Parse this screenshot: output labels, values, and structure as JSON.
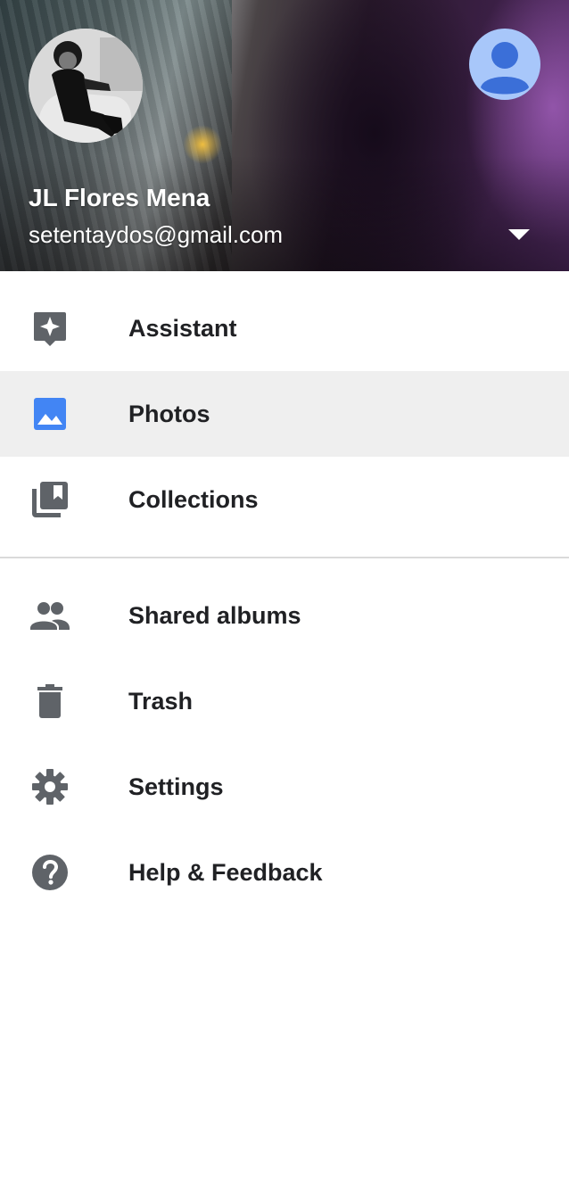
{
  "account": {
    "name": "JL Flores Mena",
    "email": "setentaydos@gmail.com"
  },
  "icons": {
    "profile": "profile-photo",
    "switch_account": "account-circle-icon",
    "dropdown": "arrow-drop-down-icon"
  },
  "colors": {
    "accent": "#4285f4",
    "icon_gray": "#5f6368",
    "selected_bg": "#efefef",
    "avatar_bg": "#a8c7fa"
  },
  "menu": {
    "primary": [
      {
        "label": "Assistant",
        "icon": "assistant-icon",
        "selected": false
      },
      {
        "label": "Photos",
        "icon": "photo-icon",
        "selected": true
      },
      {
        "label": "Collections",
        "icon": "collections-bookmark-icon",
        "selected": false
      }
    ],
    "secondary": [
      {
        "label": "Shared albums",
        "icon": "people-icon"
      },
      {
        "label": "Trash",
        "icon": "trash-icon"
      },
      {
        "label": "Settings",
        "icon": "gear-icon"
      },
      {
        "label": "Help & Feedback",
        "icon": "help-icon"
      }
    ]
  }
}
